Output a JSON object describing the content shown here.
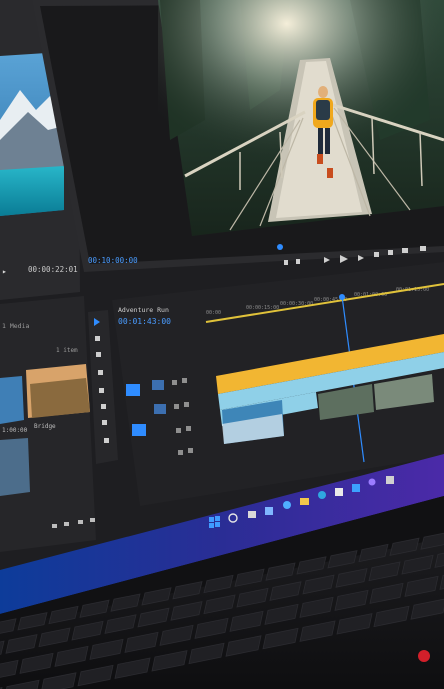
{
  "editor": {
    "source_timecode": "00:00:22:01",
    "program_timecode": "00:10:00:00",
    "sequence_tab": "Adventure Run",
    "sequence_timecode": "00:01:43:00",
    "ruler_labels": [
      "00:00",
      "00:00:15:00",
      "00:00:30:00",
      "00:00:45:00",
      "00:01:00:00",
      "00:01:15:00"
    ],
    "project_label_1": "1 Media",
    "project_label_2": "1 item",
    "thumb_caption_1": "1:00:00",
    "thumb_caption_2": "Bridge"
  },
  "icons": {
    "taskbar": [
      "windows-start-icon",
      "search-icon",
      "task-view-icon",
      "widgets-icon",
      "edge-icon",
      "file-explorer-icon",
      "store-icon",
      "mail-icon",
      "premiere-icon"
    ],
    "tools": [
      "selection-tool-icon",
      "track-select-icon",
      "ripple-edit-icon",
      "razor-icon",
      "slip-icon",
      "pen-icon",
      "hand-icon",
      "type-icon"
    ]
  },
  "colors": {
    "accent_blue": "#2f8cff",
    "clip_yellow": "#f2b632",
    "clip_light_blue": "#8fd0e8",
    "panel_bg": "#232326",
    "taskbar_blue": "#1b2f8a"
  }
}
